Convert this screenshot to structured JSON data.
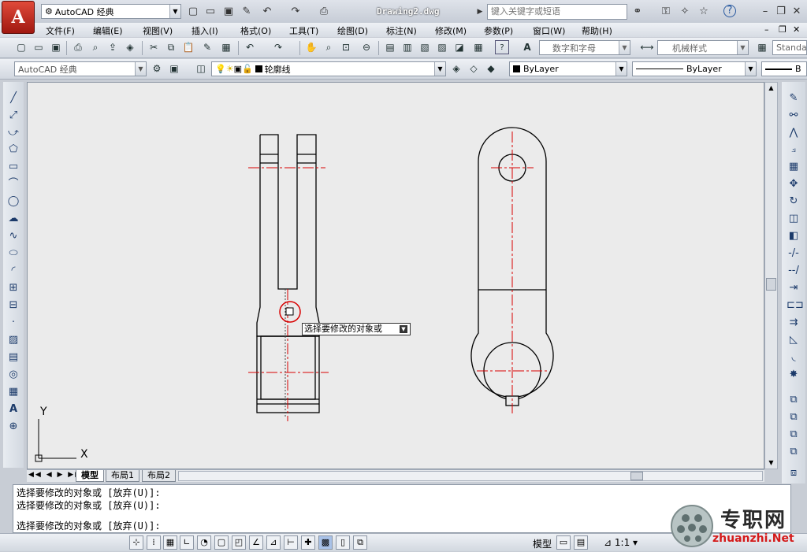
{
  "title_bar": {
    "workspace": "AutoCAD 经典",
    "document": "Drawing2.dwg",
    "search_placeholder": "键入关键字或短语"
  },
  "menu": [
    "文件(F)",
    "编辑(E)",
    "视图(V)",
    "插入(I)",
    "格式(O)",
    "工具(T)",
    "绘图(D)",
    "标注(N)",
    "修改(M)",
    "参数(P)",
    "窗口(W)",
    "帮助(H)"
  ],
  "toolbar": {
    "text_style": "数字和字母",
    "dim_style": "机械样式",
    "table_style": "Standa",
    "workspace_combo": "AutoCAD 经典",
    "layer": "轮廓线",
    "color": "ByLayer",
    "linetype": "ByLayer",
    "lineweight": "B"
  },
  "canvas": {
    "tooltip": "选择要修改的对象或",
    "ucs_x": "X",
    "ucs_y": "Y"
  },
  "tabs": [
    "模型",
    "布局1",
    "布局2"
  ],
  "command_lines": [
    "选择要修改的对象或 [放弃(U)]:",
    "选择要修改的对象或 [放弃(U)]:",
    "",
    "选择要修改的对象或 [放弃(U)]:"
  ],
  "status": {
    "model_label": "模型",
    "scale": "1:1"
  },
  "watermark": {
    "cn": "专职网",
    "url": "zhuanzhi.Net"
  },
  "icons": {
    "app": "autocad-logo-icon",
    "gear": "gear-icon"
  }
}
